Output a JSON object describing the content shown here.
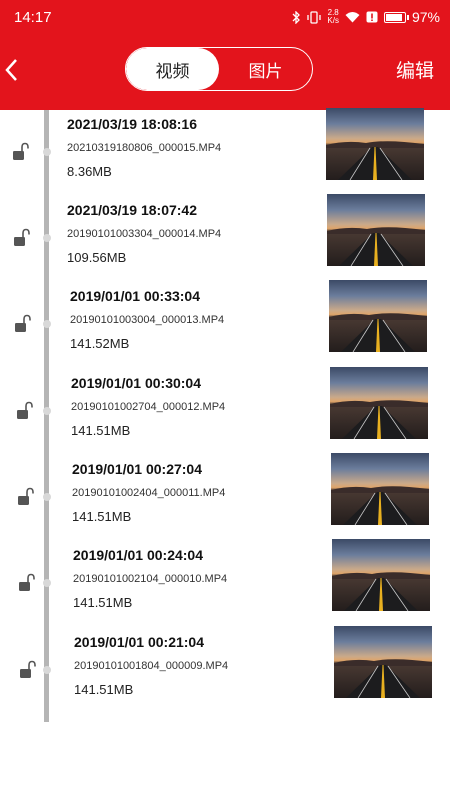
{
  "status_bar": {
    "time": "14:17",
    "network_speed_value": "2.8",
    "network_speed_unit": "K/s",
    "battery_text": "97%",
    "battery_level": 0.97
  },
  "nav": {
    "tabs": [
      {
        "label": "视频",
        "active": true
      },
      {
        "label": "图片",
        "active": false
      }
    ],
    "edit_label": "编辑"
  },
  "colors": {
    "primary": "#e3141c",
    "timeline": "#b5b5b5"
  },
  "icons": {
    "back": "chevron-left-icon",
    "lock": "unlock-icon"
  },
  "videos": [
    {
      "datetime": "2021/03/19 18:08:16",
      "filename": "20210319180806_000015.MP4",
      "size": "8.36MB"
    },
    {
      "datetime": "2021/03/19 18:07:42",
      "filename": "20190101003304_000014.MP4",
      "size": "109.56MB"
    },
    {
      "datetime": "2019/01/01 00:33:04",
      "filename": "20190101003004_000013.MP4",
      "size": "141.52MB"
    },
    {
      "datetime": "2019/01/01 00:30:04",
      "filename": "20190101002704_000012.MP4",
      "size": "141.51MB"
    },
    {
      "datetime": "2019/01/01 00:27:04",
      "filename": "20190101002404_000011.MP4",
      "size": "141.51MB"
    },
    {
      "datetime": "2019/01/01 00:24:04",
      "filename": "20190101002104_000010.MP4",
      "size": "141.51MB"
    },
    {
      "datetime": "2019/01/01 00:21:04",
      "filename": "20190101001804_000009.MP4",
      "size": "141.51MB"
    }
  ]
}
